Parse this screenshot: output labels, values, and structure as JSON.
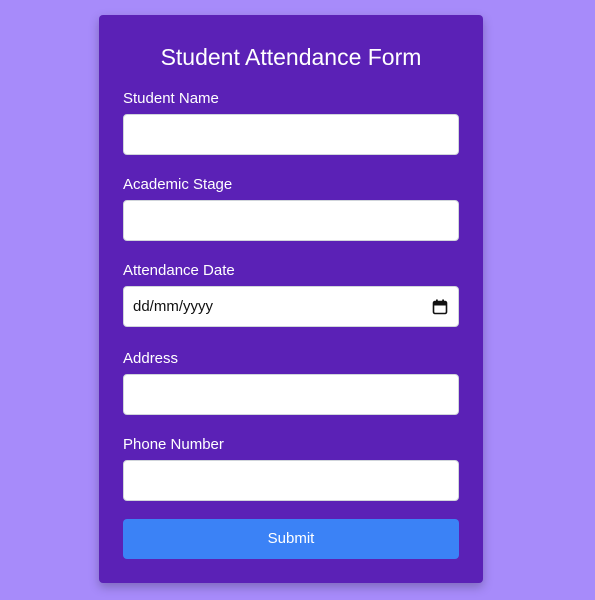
{
  "form": {
    "title": "Student Attendance Form",
    "fields": [
      {
        "label": "Student Name",
        "value": ""
      },
      {
        "label": "Academic Stage",
        "value": ""
      },
      {
        "label": "Attendance Date",
        "value": "dd/mm/yyyy"
      },
      {
        "label": "Address",
        "value": ""
      },
      {
        "label": "Phone Number",
        "value": ""
      }
    ],
    "submit_label": "Submit"
  },
  "colors": {
    "page_background": "#a78bfa",
    "card_background": "#5b21b6",
    "submit_button": "#3b82f6",
    "input_background": "#ffffff"
  },
  "icons": {
    "date_picker": "calendar-icon"
  }
}
